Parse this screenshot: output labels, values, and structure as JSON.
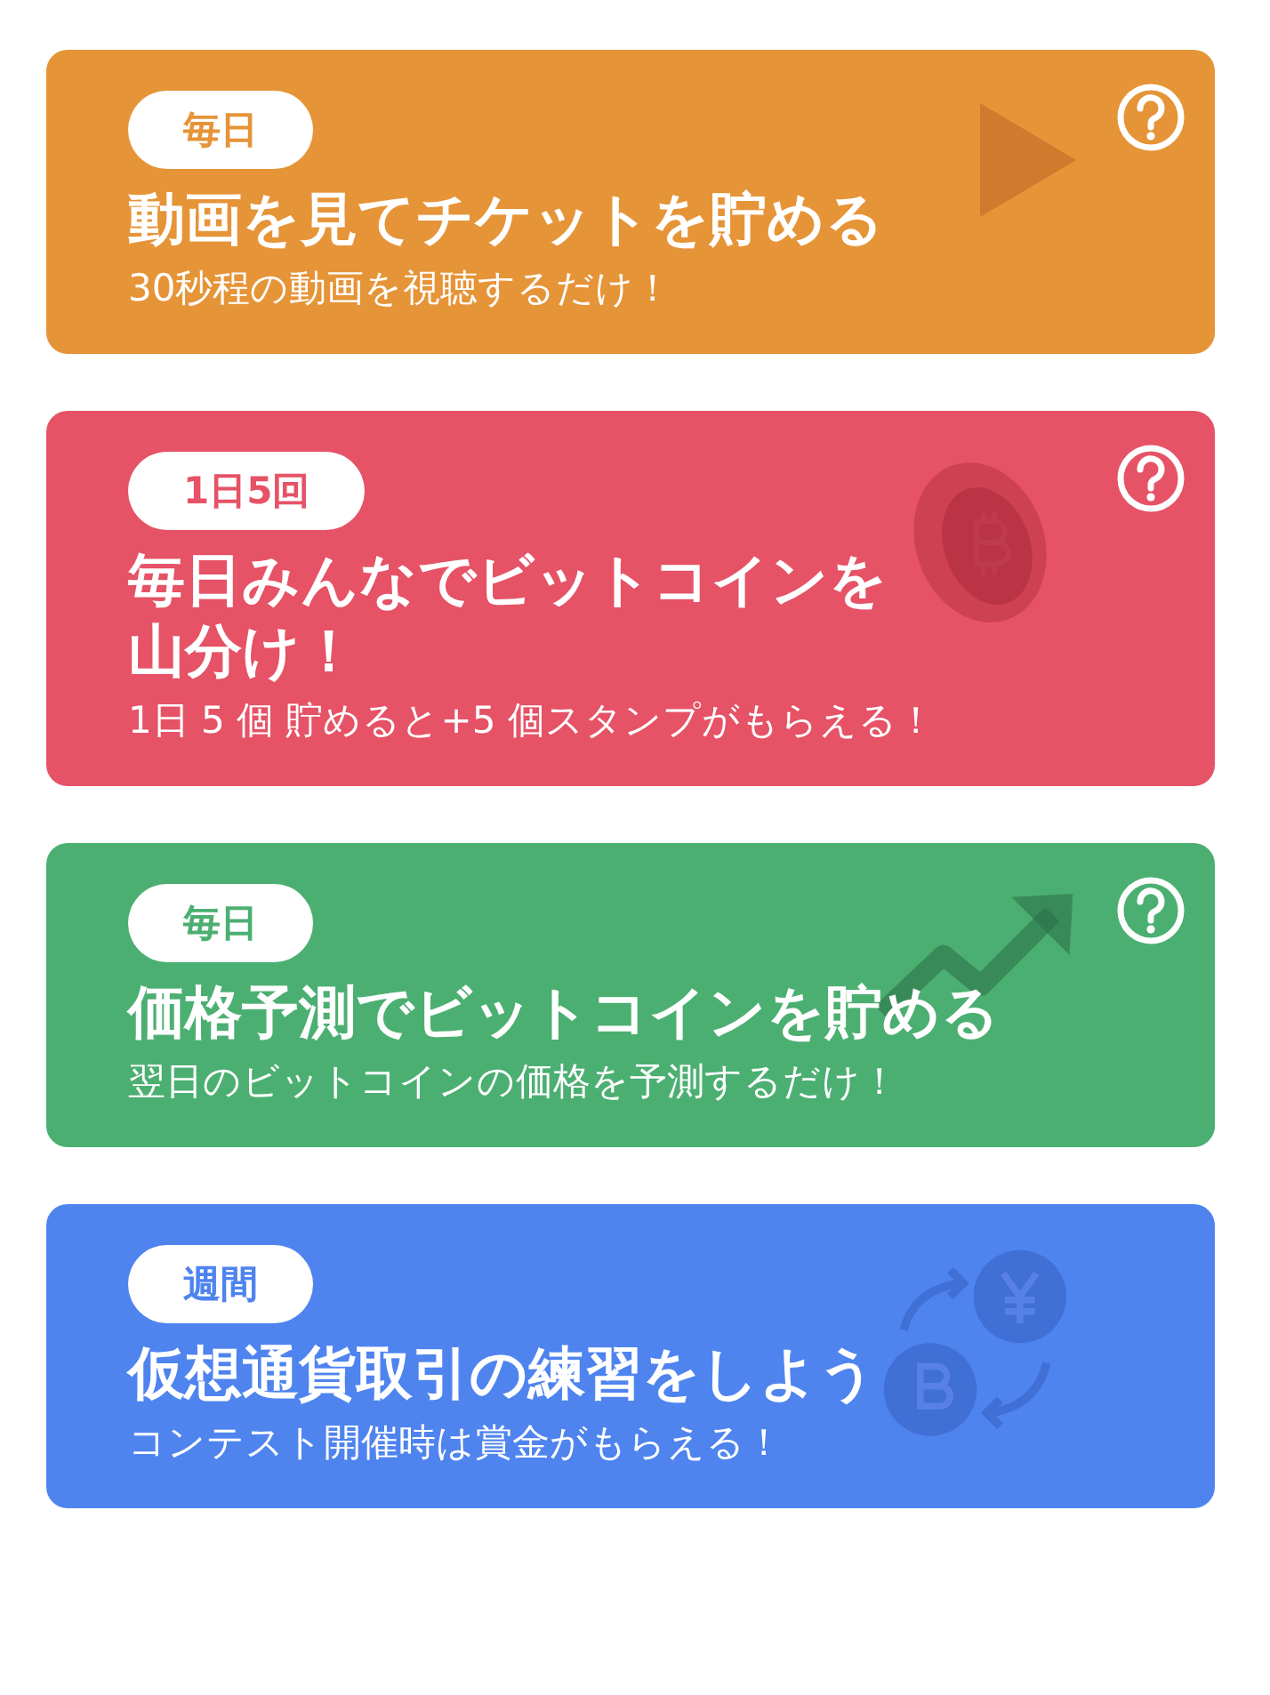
{
  "cards": [
    {
      "badge": "毎日",
      "title": "動画を見てチケットを貯める",
      "subtitle": "30秒程の動画を視聴するだけ！",
      "color": "#e69438",
      "kind": "play",
      "help": true
    },
    {
      "badge": "1日5回",
      "title": "毎日みんなでビットコインを",
      "title_line_2": "山分け！",
      "subtitle": "1日 5 個 貯めると+5 個スタンプがもらえる！",
      "color": "#e65266",
      "kind": "coin",
      "help": true
    },
    {
      "badge": "毎日",
      "title": "価格予測でビットコインを貯める",
      "subtitle": "翌日のビットコインの価格を予測するだけ！",
      "color": "#4caf72",
      "kind": "chart",
      "help": true
    },
    {
      "badge": "週間",
      "title": "仮想通貨取引の練習をしよう",
      "subtitle": "コンテスト開催時は賞金がもらえる！",
      "color": "#4f84ef",
      "kind": "exchange",
      "help": false
    }
  ]
}
